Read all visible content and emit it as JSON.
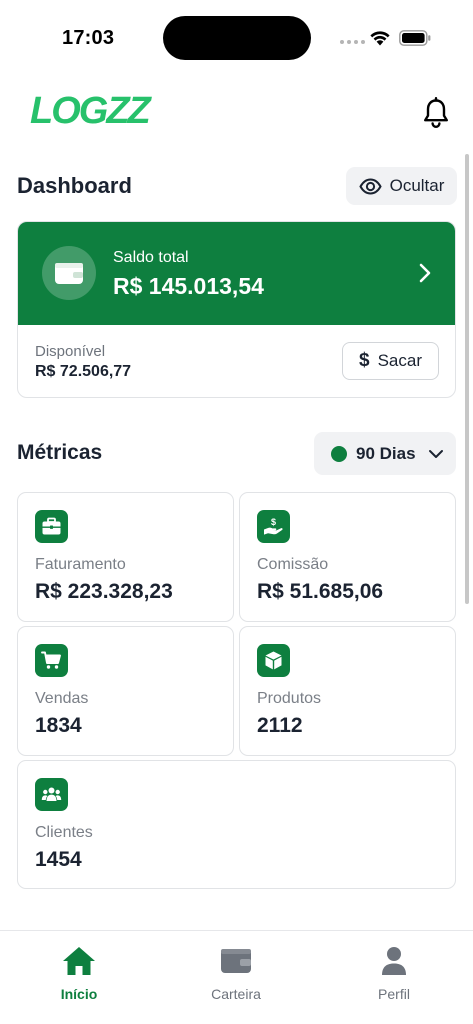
{
  "status_bar": {
    "time": "17:03"
  },
  "header": {
    "logo_text": "LOGZZ"
  },
  "dashboard": {
    "title": "Dashboard",
    "hide_label": "Ocultar",
    "balance": {
      "label": "Saldo total",
      "value": "R$ 145.013,54",
      "available_label": "Disponível",
      "available_value": "R$ 72.506,77",
      "withdraw_symbol": "$",
      "withdraw_label": "Sacar"
    }
  },
  "metrics": {
    "title": "Métricas",
    "period": "90 Dias",
    "cards": [
      {
        "icon": "briefcase-icon",
        "label": "Faturamento",
        "value": "R$ 223.328,23"
      },
      {
        "icon": "hand-coin-icon",
        "label": "Comissão",
        "value": "R$ 51.685,06"
      },
      {
        "icon": "cart-icon",
        "label": "Vendas",
        "value": "1834"
      },
      {
        "icon": "box-icon",
        "label": "Produtos",
        "value": "2112"
      },
      {
        "icon": "users-icon",
        "label": "Clientes",
        "value": "1454"
      }
    ]
  },
  "bottom_nav": {
    "items": [
      {
        "icon": "home-icon",
        "label": "Início",
        "active": true
      },
      {
        "icon": "wallet-icon",
        "label": "Carteira",
        "active": false
      },
      {
        "icon": "user-icon",
        "label": "Perfil",
        "active": false
      }
    ]
  },
  "colors": {
    "brand": "#0e7f3f",
    "logo": "#27c16b",
    "text": "#1b2331",
    "muted": "#7a7f87"
  }
}
